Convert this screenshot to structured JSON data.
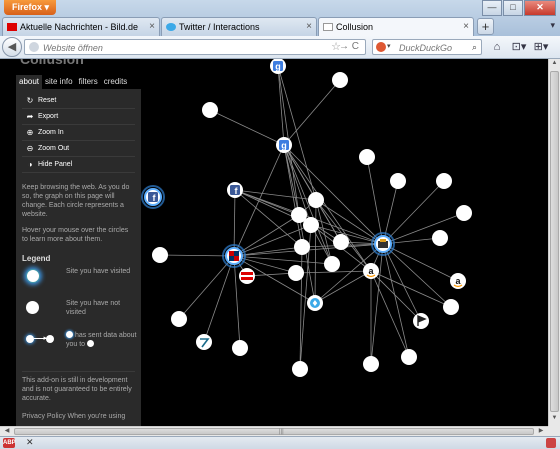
{
  "browser": {
    "menu_button": "Firefox",
    "window_controls": [
      "—",
      "□",
      "✕"
    ],
    "tabs": [
      {
        "title": "Aktuelle Nachrichten - Bild.de",
        "close": "×"
      },
      {
        "title": "Twitter / Interactions",
        "close": "×"
      },
      {
        "title": "Collusion",
        "close": "×"
      }
    ],
    "new_tab": "+",
    "tab_list": "▾",
    "back": "◀",
    "url_placeholder": "Website öffnen",
    "url_star": "☆",
    "url_go": "→ C",
    "search_engine": "DuckDuckGo",
    "search_dropdown": "▾",
    "search_button": "⌕",
    "nav_icons": [
      "⌂",
      "⊡▾",
      "⊞▾"
    ]
  },
  "page": {
    "title": "Collusion",
    "tabs": [
      "about",
      "site info",
      "filters",
      "credits"
    ],
    "menu": [
      {
        "icon": "↻",
        "label": "Reset"
      },
      {
        "icon": "➦",
        "label": "Export"
      },
      {
        "icon": "⊕",
        "label": "Zoom In"
      },
      {
        "icon": "⊖",
        "label": "Zoom Out"
      },
      {
        "icon": "◑",
        "label": "Hide Panel"
      }
    ],
    "intro": "Keep browsing the web. As you do so, the graph on this page will change. Each circle represents a website.",
    "hover_hint": "Hover your mouse over the circles to learn more about them.",
    "legend_title": "Legend",
    "legend": {
      "visited": "Site you have visited",
      "not_visited": "Site you have not visited",
      "sent_data_pre": "has sent data about you to"
    },
    "addon_note": "This add-on is still in development and is not guaranteed to be entirely accurate.",
    "privacy": "Privacy Policy When you're using"
  },
  "graph": {
    "nodes": [
      {
        "id": "google-top",
        "visited": false,
        "icon": "google"
      },
      {
        "id": "n-340-80",
        "visited": false
      },
      {
        "id": "n-210-110",
        "visited": false
      },
      {
        "id": "google",
        "visited": false,
        "icon": "google"
      },
      {
        "id": "n-367-157",
        "visited": false
      },
      {
        "id": "facebook-left",
        "visited": true,
        "icon": "facebook"
      },
      {
        "id": "facebook",
        "visited": false,
        "icon": "facebook"
      },
      {
        "id": "n-398-181",
        "visited": false
      },
      {
        "id": "n-444-181",
        "visited": false
      },
      {
        "id": "n-316-200",
        "visited": false
      },
      {
        "id": "n-299-215",
        "visited": false
      },
      {
        "id": "n-464-213",
        "visited": false
      },
      {
        "id": "n-311-225",
        "visited": false
      },
      {
        "id": "n-440-238",
        "visited": false
      },
      {
        "id": "bild",
        "visited": true,
        "icon": "bild"
      },
      {
        "id": "n-341-242",
        "visited": false
      },
      {
        "id": "n-302-247",
        "visited": false
      },
      {
        "id": "collusion",
        "visited": true,
        "icon": "collusion"
      },
      {
        "id": "n-160-255",
        "visited": false
      },
      {
        "id": "n-332-264",
        "visited": false
      },
      {
        "id": "amazon",
        "visited": false,
        "icon": "amazon"
      },
      {
        "id": "n-296-273",
        "visited": false
      },
      {
        "id": "bild-de",
        "visited": false,
        "icon": "bildflag"
      },
      {
        "id": "amazon2",
        "visited": false,
        "icon": "amazon"
      },
      {
        "id": "n-451-307",
        "visited": false
      },
      {
        "id": "twitter",
        "visited": false,
        "icon": "twitter"
      },
      {
        "id": "n-179-319",
        "visited": false
      },
      {
        "id": "flag-421",
        "visited": false,
        "icon": "flag"
      },
      {
        "id": "tweetmeme",
        "visited": false,
        "icon": "tweet"
      },
      {
        "id": "n-240-348",
        "visited": false
      },
      {
        "id": "n-409-357",
        "visited": false
      },
      {
        "id": "n-371-364",
        "visited": false
      },
      {
        "id": "n-300-369",
        "visited": false
      }
    ]
  }
}
